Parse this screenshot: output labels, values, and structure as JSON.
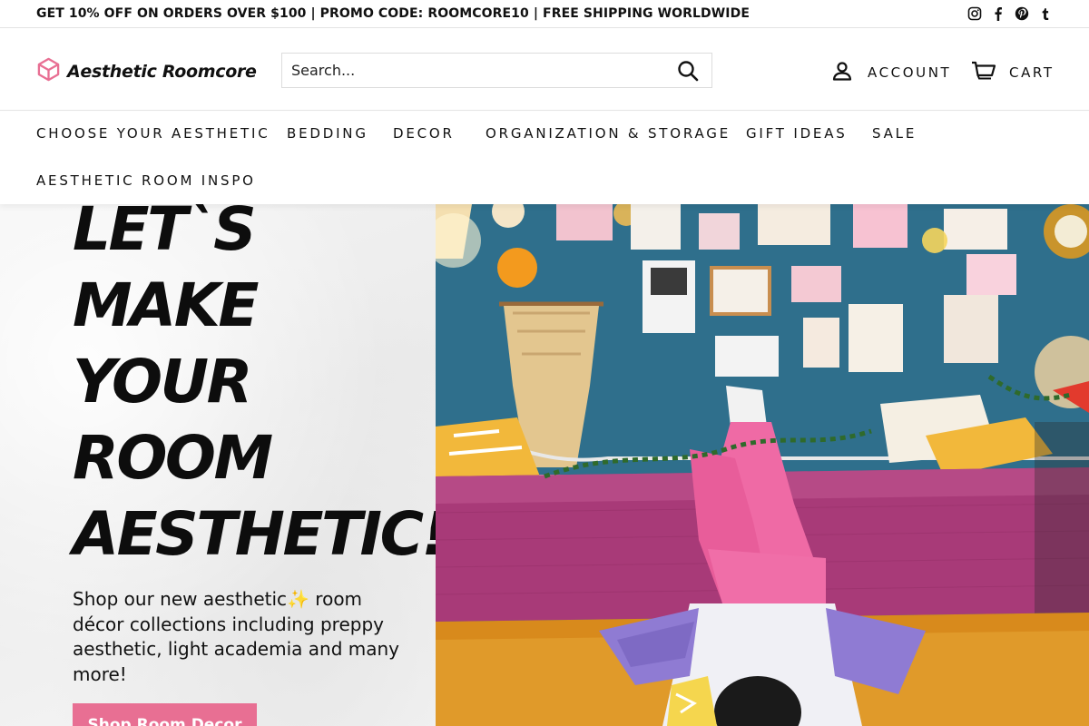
{
  "announcement": {
    "text": "GET 10% OFF ON ORDERS OVER $100 | PROMO CODE: ROOMCORE10 | FREE SHIPPING WORLDWIDE",
    "social_icons": [
      "instagram-icon",
      "facebook-icon",
      "pinterest-icon",
      "tumblr-icon"
    ]
  },
  "header": {
    "logo_text": "Aesthetic Roomcore",
    "search": {
      "placeholder": "Search..."
    },
    "account_label": "ACCOUNT",
    "cart_label": "CART"
  },
  "nav": {
    "items": [
      "CHOOSE YOUR AESTHETIC",
      "BEDDING",
      "DECOR",
      "ORGANIZATION & STORAGE",
      "GIFT IDEAS",
      "SALE",
      "AESTHETIC ROOM INSPO"
    ]
  },
  "hero": {
    "headline_lines": [
      "LET`S",
      "MAKE",
      "YOUR",
      "ROOM",
      "AESTHETIC!"
    ],
    "subtext": "Shop our new aesthetic✨ room décor collections including preppy aesthetic, light academia and many more!",
    "button_label": "Shop Room Decor"
  },
  "colors": {
    "accent_pink": "#e86f93",
    "logo_pink": "#e86f93",
    "wall_blue": "#2e6b86",
    "bedspread_magenta": "#a83a78",
    "rug_orange": "#d88a1c"
  }
}
